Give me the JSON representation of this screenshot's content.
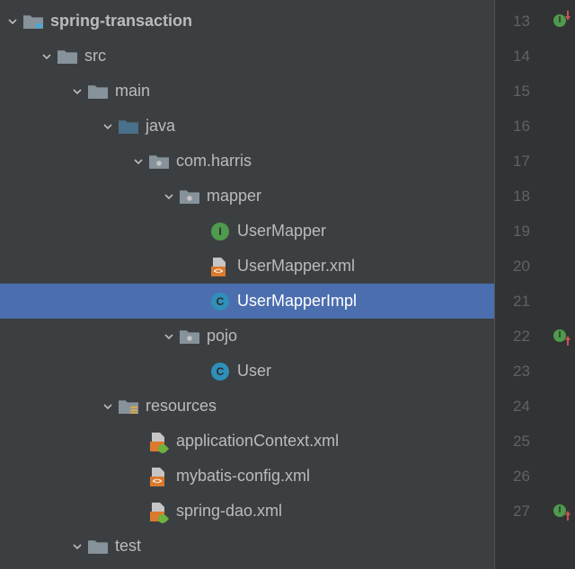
{
  "tree": {
    "module": "spring-transaction",
    "src": "src",
    "main": "main",
    "java": "java",
    "pkg_root": "com.harris",
    "pkg_mapper": "mapper",
    "file_usermapper": "UserMapper",
    "file_usermapper_xml": "UserMapper.xml",
    "file_usermapper_impl": "UserMapperImpl",
    "pkg_pojo": "pojo",
    "file_user": "User",
    "resources": "resources",
    "file_appctx": "applicationContext.xml",
    "file_mybatis": "mybatis-config.xml",
    "file_springdao": "spring-dao.xml",
    "test": "test"
  },
  "gutter": {
    "lines": [
      "13",
      "14",
      "15",
      "16",
      "17",
      "18",
      "19",
      "20",
      "21",
      "22",
      "23",
      "24",
      "25",
      "26",
      "27"
    ],
    "markers": {
      "13": "impl-down",
      "22": "impl-up",
      "27": "impl-up"
    }
  }
}
